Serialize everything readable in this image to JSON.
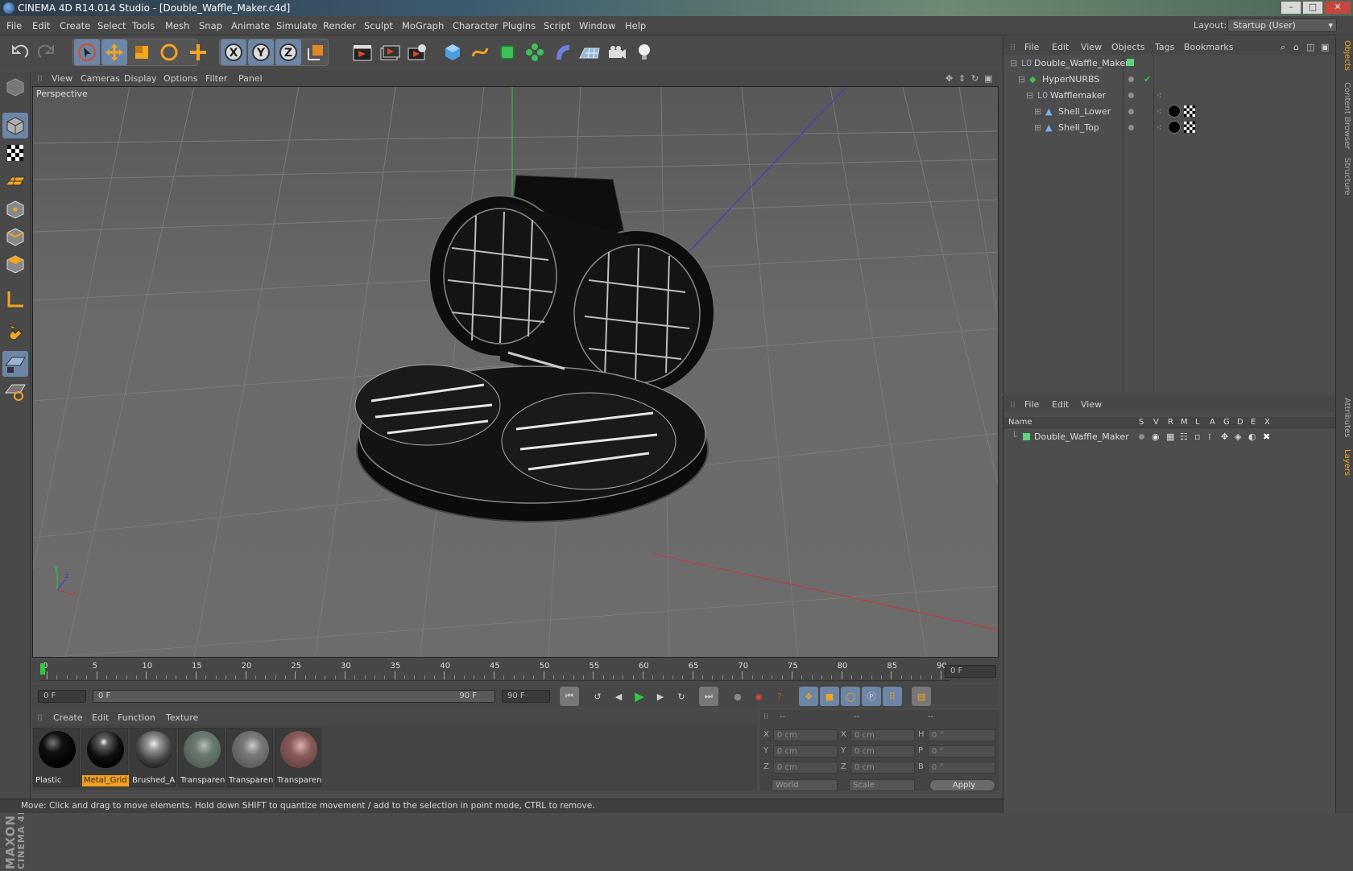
{
  "window": {
    "title": "CINEMA 4D R14.014 Studio - [Double_Waffle_Maker.c4d]",
    "min": "–",
    "max": "□",
    "close": "✕"
  },
  "menubar": {
    "items": [
      "File",
      "Edit",
      "Create",
      "Select",
      "Tools",
      "Mesh",
      "Snap",
      "Animate",
      "Simulate",
      "Render",
      "Sculpt",
      "MoGraph",
      "Character",
      "Plugins",
      "Script",
      "Window",
      "Help"
    ],
    "layout_label": "Layout:",
    "layout_value": "Startup (User)"
  },
  "toolbar": {
    "axis_x": "X",
    "axis_y": "Y",
    "axis_z": "Z"
  },
  "viewport": {
    "menu": [
      "View",
      "Cameras",
      "Display",
      "Options",
      "Filter",
      "Panel"
    ],
    "label": "Perspective",
    "axis_x": "x",
    "axis_y": "y",
    "axis_z": "z"
  },
  "timeline": {
    "ticks": [
      "0",
      "5",
      "10",
      "15",
      "20",
      "25",
      "30",
      "35",
      "40",
      "45",
      "50",
      "55",
      "60",
      "65",
      "70",
      "75",
      "80",
      "85",
      "90"
    ],
    "current_frame": "0 F",
    "start": "0 F",
    "range_start": "0 F",
    "range_end": "90 F",
    "end": "90 F"
  },
  "materials": {
    "menu": [
      "Create",
      "Edit",
      "Function",
      "Texture"
    ],
    "items": [
      {
        "name": "Plastic",
        "selected": false
      },
      {
        "name": "Metal_Grid",
        "selected": true
      },
      {
        "name": "Brushed_A",
        "selected": false
      },
      {
        "name": "Transparen",
        "selected": false
      },
      {
        "name": "Transparen",
        "selected": false
      },
      {
        "name": "Transparen",
        "selected": false
      }
    ]
  },
  "coords": {
    "header": [
      "--",
      "--",
      "--"
    ],
    "rows": [
      {
        "a": "X",
        "av": "0 cm",
        "b": "X",
        "bv": "0 cm",
        "c": "H",
        "cv": "0 °"
      },
      {
        "a": "Y",
        "av": "0 cm",
        "b": "Y",
        "bv": "0 cm",
        "c": "P",
        "cv": "0 °"
      },
      {
        "a": "Z",
        "av": "0 cm",
        "b": "Z",
        "bv": "0 cm",
        "c": "B",
        "cv": "0 °"
      }
    ],
    "world": "World",
    "scale": "Scale",
    "apply": "Apply"
  },
  "status": "Move: Click and drag to move elements. Hold down SHIFT to quantize movement / add to the selection in point mode, CTRL to remove.",
  "objects": {
    "menu": [
      "File",
      "Edit",
      "View",
      "Objects",
      "Tags",
      "Bookmarks"
    ],
    "tree": [
      "Double_Waffle_Maker",
      "HyperNURBS",
      "Wafflemaker",
      "Shell_Lower",
      "Shell_Top"
    ]
  },
  "layers": {
    "menu": [
      "File",
      "Edit",
      "View"
    ],
    "headers": [
      "Name",
      "S",
      "V",
      "R",
      "M",
      "L",
      "A",
      "G",
      "D",
      "E",
      "X"
    ],
    "rows": [
      "Double_Waffle_Maker"
    ]
  },
  "side_tabs": [
    "Objects",
    "Content Browser",
    "Structure",
    "Attributes",
    "Layers"
  ]
}
